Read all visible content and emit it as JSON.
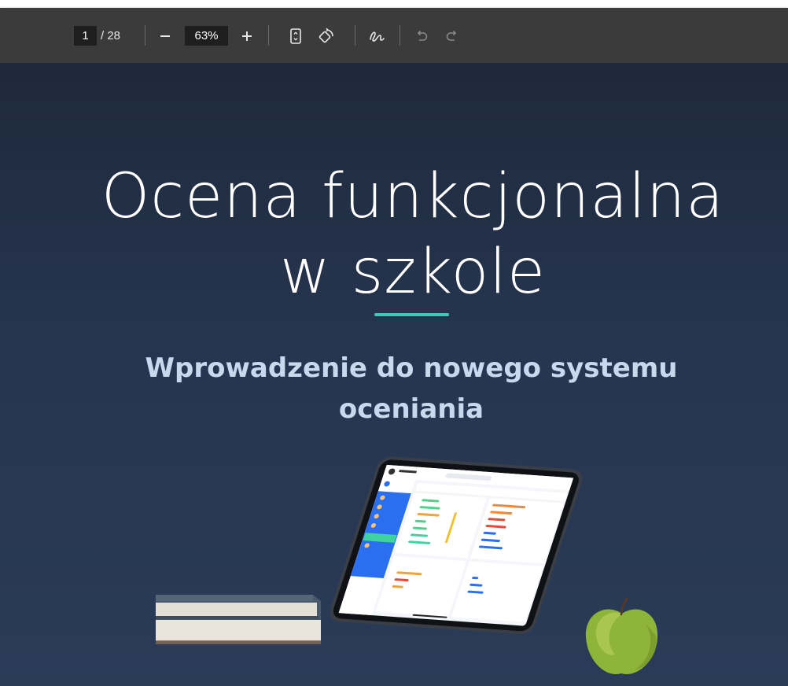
{
  "viewer": {
    "current_page": "1",
    "total_pages": "/ 28",
    "zoom": "63%",
    "icons": [
      "minus-icon",
      "plus-icon",
      "fit-page-icon",
      "rotate-icon",
      "draw-icon",
      "undo-icon",
      "redo-icon"
    ]
  },
  "slide": {
    "title_line1": "Ocena funkcjonalna",
    "title_line2": "w szkole",
    "subtitle_line1": "Wprowadzenie do nowego systemu",
    "subtitle_line2": "oceniania",
    "colors": {
      "background_top": "#1e293b",
      "background_bottom": "#2a3b58",
      "accent": "#3cc9b6",
      "subtitle": "#c8d9ee"
    }
  }
}
